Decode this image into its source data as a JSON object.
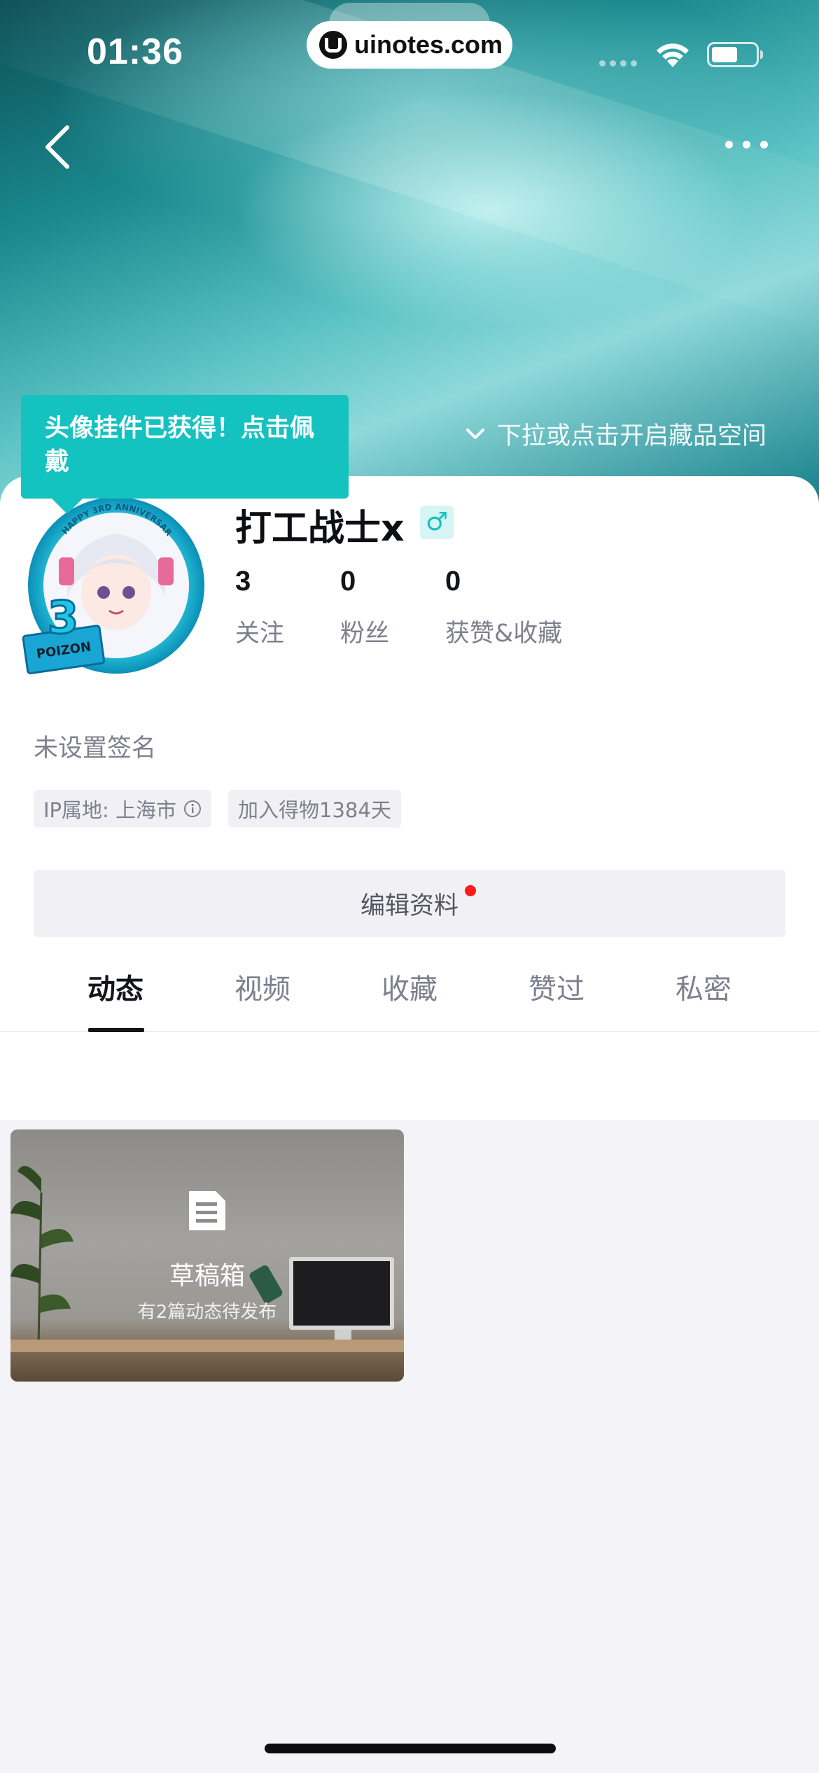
{
  "status_bar": {
    "time": "01:36"
  },
  "watermark": {
    "text": "uinotes.com"
  },
  "banner": {
    "tooltip": "头像挂件已获得！点击佩戴",
    "pull_hint": "下拉或点击开启藏品空间"
  },
  "profile": {
    "name": "打工战士x",
    "gender_symbol": "♂",
    "stats": [
      {
        "num": "3",
        "label": "关注"
      },
      {
        "num": "0",
        "label": "粉丝"
      },
      {
        "num": "0",
        "label": "获赞&收藏"
      }
    ],
    "signature": "未设置签名",
    "tags": {
      "ip": "IP属地: 上海市",
      "joined": "加入得物1384天"
    },
    "edit_button": "编辑资料",
    "avatar_badge_text": "HAPPY 3RD ANNIVERSARY",
    "avatar_badge_number": "3",
    "avatar_badge_brand": "POIZON"
  },
  "tabs": [
    "动态",
    "视频",
    "收藏",
    "赞过",
    "私密"
  ],
  "drafts": {
    "title": "草稿箱",
    "subtitle": "有2篇动态待发布"
  },
  "colors": {
    "accent": "#14c2c0",
    "notification_dot": "#ff1a1a"
  }
}
